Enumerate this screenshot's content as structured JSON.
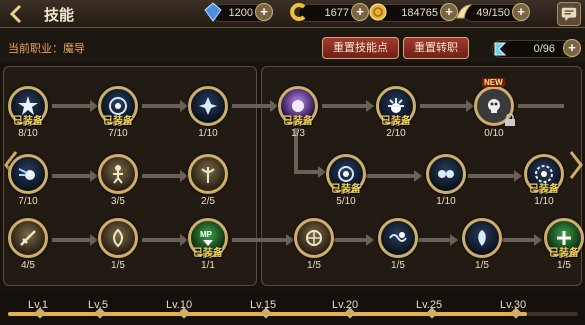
{
  "header": {
    "title": "技能"
  },
  "resources": [
    {
      "icon": "blue-crystal-icon",
      "value": "1200"
    },
    {
      "icon": "gold-c-icon",
      "value": "1677"
    },
    {
      "icon": "gold-coin-icon",
      "value": "184765"
    },
    {
      "icon": "wing-energy-icon",
      "value": "49/150"
    }
  ],
  "subbar": {
    "job_label": "当前职业：魔导",
    "reset_skill_points": "重置技能点",
    "reset_job": "重置转职",
    "skill_points": "0/96"
  },
  "skills": [
    {
      "id": "s1",
      "tag": "已装备",
      "level": "8/10"
    },
    {
      "id": "s2",
      "tag": "已装备",
      "level": "7/10"
    },
    {
      "id": "s3",
      "tag": "",
      "level": "1/10"
    },
    {
      "id": "s4",
      "tag": "已装备",
      "level": "1/3"
    },
    {
      "id": "s5",
      "tag": "已装备",
      "level": "2/10"
    },
    {
      "id": "s6",
      "tag": "",
      "level": "0/10",
      "new": "NEW"
    },
    {
      "id": "s7",
      "tag": "",
      "level": "7/10"
    },
    {
      "id": "s8",
      "tag": "",
      "level": "3/5"
    },
    {
      "id": "s9",
      "tag": "",
      "level": "2/5"
    },
    {
      "id": "s10",
      "tag": "已装备",
      "level": "5/10"
    },
    {
      "id": "s11",
      "tag": "",
      "level": "1/10"
    },
    {
      "id": "s12",
      "tag": "已装备",
      "level": "1/10"
    },
    {
      "id": "s13",
      "tag": "",
      "level": "4/5"
    },
    {
      "id": "s14",
      "tag": "",
      "level": "1/5"
    },
    {
      "id": "s15",
      "tag": "已装备",
      "level": "1/1"
    },
    {
      "id": "s16",
      "tag": "",
      "level": "1/5"
    },
    {
      "id": "s17",
      "tag": "",
      "level": "1/5"
    },
    {
      "id": "s18",
      "tag": "",
      "level": "1/5"
    },
    {
      "id": "s19",
      "tag": "已装备",
      "level": "1/5"
    }
  ],
  "timeline": {
    "labels": [
      "Lv.1",
      "Lv.5",
      "Lv.10",
      "Lv.15",
      "Lv.20",
      "Lv.25",
      "Lv.30"
    ],
    "progress": 0.91
  },
  "colors": {
    "accent_gold": "#cfae6a",
    "button_red": "#a33a2e",
    "equipped_yellow": "#f0d25a"
  }
}
